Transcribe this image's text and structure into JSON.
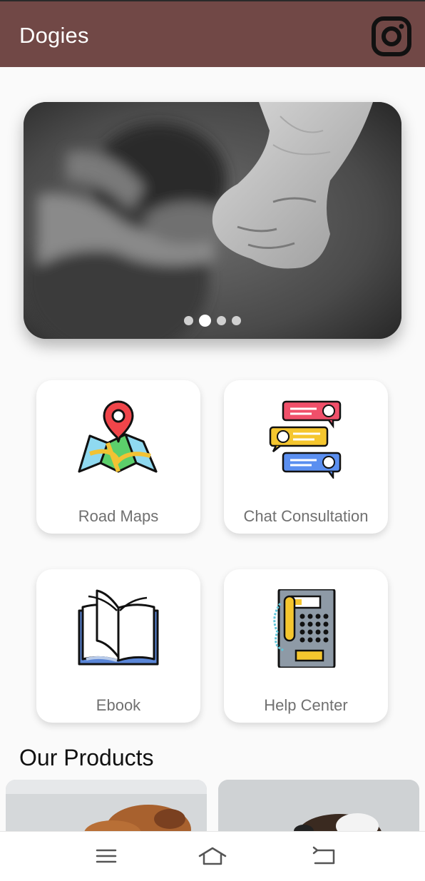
{
  "app_bar": {
    "title": "Dogies",
    "icon": "instagram-icon"
  },
  "carousel": {
    "slide_count": 4,
    "active_index": 1
  },
  "menu": [
    {
      "label": "Road Maps",
      "icon": "map-pin-icon"
    },
    {
      "label": "Chat Consultation",
      "icon": "chat-bubbles-icon"
    },
    {
      "label": "Ebook",
      "icon": "open-book-icon"
    },
    {
      "label": "Help Center",
      "icon": "payphone-icon"
    }
  ],
  "products": {
    "title": "Our Products"
  },
  "nav": {
    "menu_icon": "menu-icon",
    "home_icon": "home-icon",
    "back_icon": "back-icon"
  },
  "colors": {
    "app_bar": "#714846",
    "background": "#fafafa",
    "label": "#707070"
  }
}
